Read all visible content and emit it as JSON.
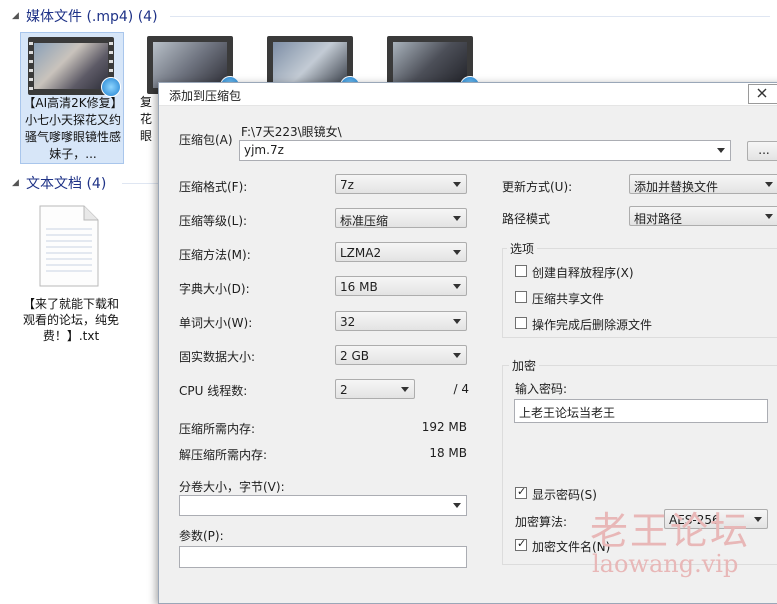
{
  "explorer": {
    "media_group": {
      "title": "媒体文件 (.mp4) (4)"
    },
    "docs_group": {
      "title": "文本文档 (4)"
    },
    "videos": [
      {
        "label": "【AI高清2K修复】小七小天探花又约骚气嗲嗲眼镜性感妹子，..."
      },
      {
        "label": "复花眼"
      }
    ],
    "doc": {
      "label": "【来了就能下载和观看的论坛，纯免费！】.txt"
    }
  },
  "dialog": {
    "title": "添加到压缩包",
    "archive": {
      "label": "压缩包(A)",
      "path": "F:\\7天223\\眼镜女\\",
      "name": "yjm.7z",
      "browse_label": "..."
    },
    "left": {
      "format": {
        "label": "压缩格式(F):",
        "value": "7z"
      },
      "level": {
        "label": "压缩等级(L):",
        "value": "标准压缩"
      },
      "method": {
        "label": "压缩方法(M):",
        "value": "LZMA2"
      },
      "dict": {
        "label": "字典大小(D):",
        "value": "16 MB"
      },
      "word": {
        "label": "单词大小(W):",
        "value": "32"
      },
      "solid": {
        "label": "固实数据大小:",
        "value": "2 GB"
      },
      "cpu": {
        "label": "CPU 线程数:",
        "value": "2",
        "total": "/ 4"
      },
      "mem_compress": {
        "label": "压缩所需内存:",
        "value": "192 MB"
      },
      "mem_decompress": {
        "label": "解压缩所需内存:",
        "value": "18 MB"
      },
      "split": {
        "label": "分卷大小，字节(V):",
        "value": ""
      },
      "params": {
        "label": "参数(P):",
        "value": ""
      }
    },
    "right": {
      "update": {
        "label": "更新方式(U):",
        "value": "添加并替换文件"
      },
      "path_mode": {
        "label": "路径模式",
        "value": "相对路径"
      },
      "options": {
        "title": "选项",
        "sfx": "创建自释放程序(X)",
        "shared": "压缩共享文件",
        "delete": "操作完成后删除源文件"
      },
      "encrypt": {
        "title": "加密",
        "pw_label": "输入密码:",
        "password": "上老王论坛当老王",
        "show_pw": "显示密码(S)",
        "algo_label": "加密算法:",
        "algo": "AES-256",
        "encrypt_names": "加密文件名(N)"
      }
    }
  },
  "watermark": {
    "line1": "老王论坛",
    "line2": "laowang.vip"
  }
}
